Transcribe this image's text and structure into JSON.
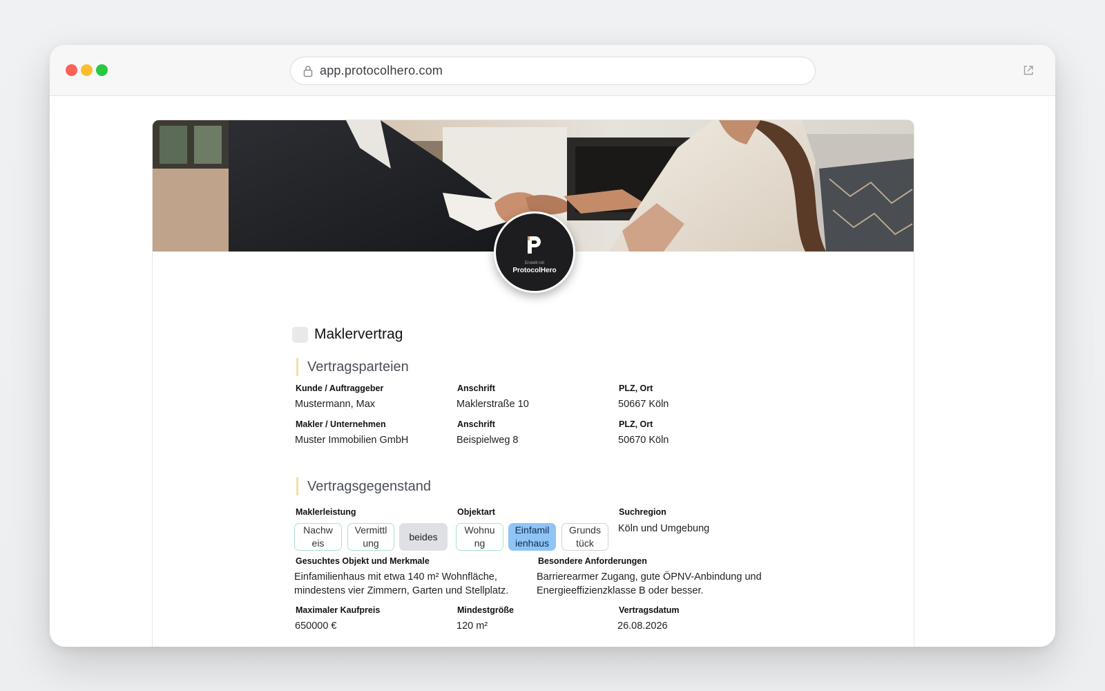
{
  "browser": {
    "url": "app.protocolhero.com",
    "icons": {
      "lock": "lock-icon",
      "external": "external-link-icon"
    }
  },
  "badge": {
    "subtitle": "Erstellt mit",
    "brand": "ProtocolHero"
  },
  "document": {
    "title": "Maklervertrag",
    "sections": {
      "parties": {
        "heading": "Vertragsparteien",
        "customer_label": "Kunde / Auftraggeber",
        "customer_value": "Mustermann, Max",
        "customer_address_label": "Anschrift",
        "customer_address_value": "Maklerstraße 10",
        "customer_city_label": "PLZ, Ort",
        "customer_city_value": "50667 Köln",
        "broker_label": "Makler / Unternehmen",
        "broker_value": "Muster Immobilien GmbH",
        "broker_address_label": "Anschrift",
        "broker_address_value": "Beispielweg 8",
        "broker_city_label": "PLZ, Ort",
        "broker_city_value": "50670 Köln"
      },
      "subject": {
        "heading": "Vertragsgegenstand",
        "service_label": "Maklerleistung",
        "service_options": [
          {
            "line1": "Nachw",
            "line2": "eis",
            "selected": false
          },
          {
            "line1": "Vermittl",
            "line2": "ung",
            "selected": false
          },
          {
            "line1": "beides",
            "line2": "",
            "selected": true
          }
        ],
        "object_label": "Objektart",
        "object_options": [
          {
            "line1": "Wohnu",
            "line2": "ng",
            "selected": false
          },
          {
            "line1": "Einfamil",
            "line2": "ienhaus",
            "selected": true
          },
          {
            "line1": "Grunds",
            "line2": "tück",
            "selected": false
          }
        ],
        "region_label": "Suchregion",
        "region_value": "Köln und Umgebung",
        "features_label": "Gesuchtes Objekt und Merkmale",
        "features_line1": "Einfamilienhaus mit etwa 140 m² Wohnfläche,",
        "features_line2": "mindestens vier Zimmern, Garten und Stellplatz.",
        "requirements_label": "Besondere Anforderungen",
        "requirements_line1": "Barrierearmer Zugang, gute ÖPNV-Anbindung und",
        "requirements_line2": "Energieeffizienzklasse B oder besser.",
        "price_label": "Maximaler Kaufpreis",
        "price_value": "650000 €",
        "size_label": "Mindestgröße",
        "size_value": "120 m²",
        "date_label": "Vertragsdatum",
        "date_value": "26.08.2026"
      }
    }
  },
  "colors": {
    "selected_gray": "#dfe0e4",
    "selected_blue": "#8fc4f6",
    "chip_border": "#a7e2cf",
    "section_accent": "#f0e0a6"
  }
}
